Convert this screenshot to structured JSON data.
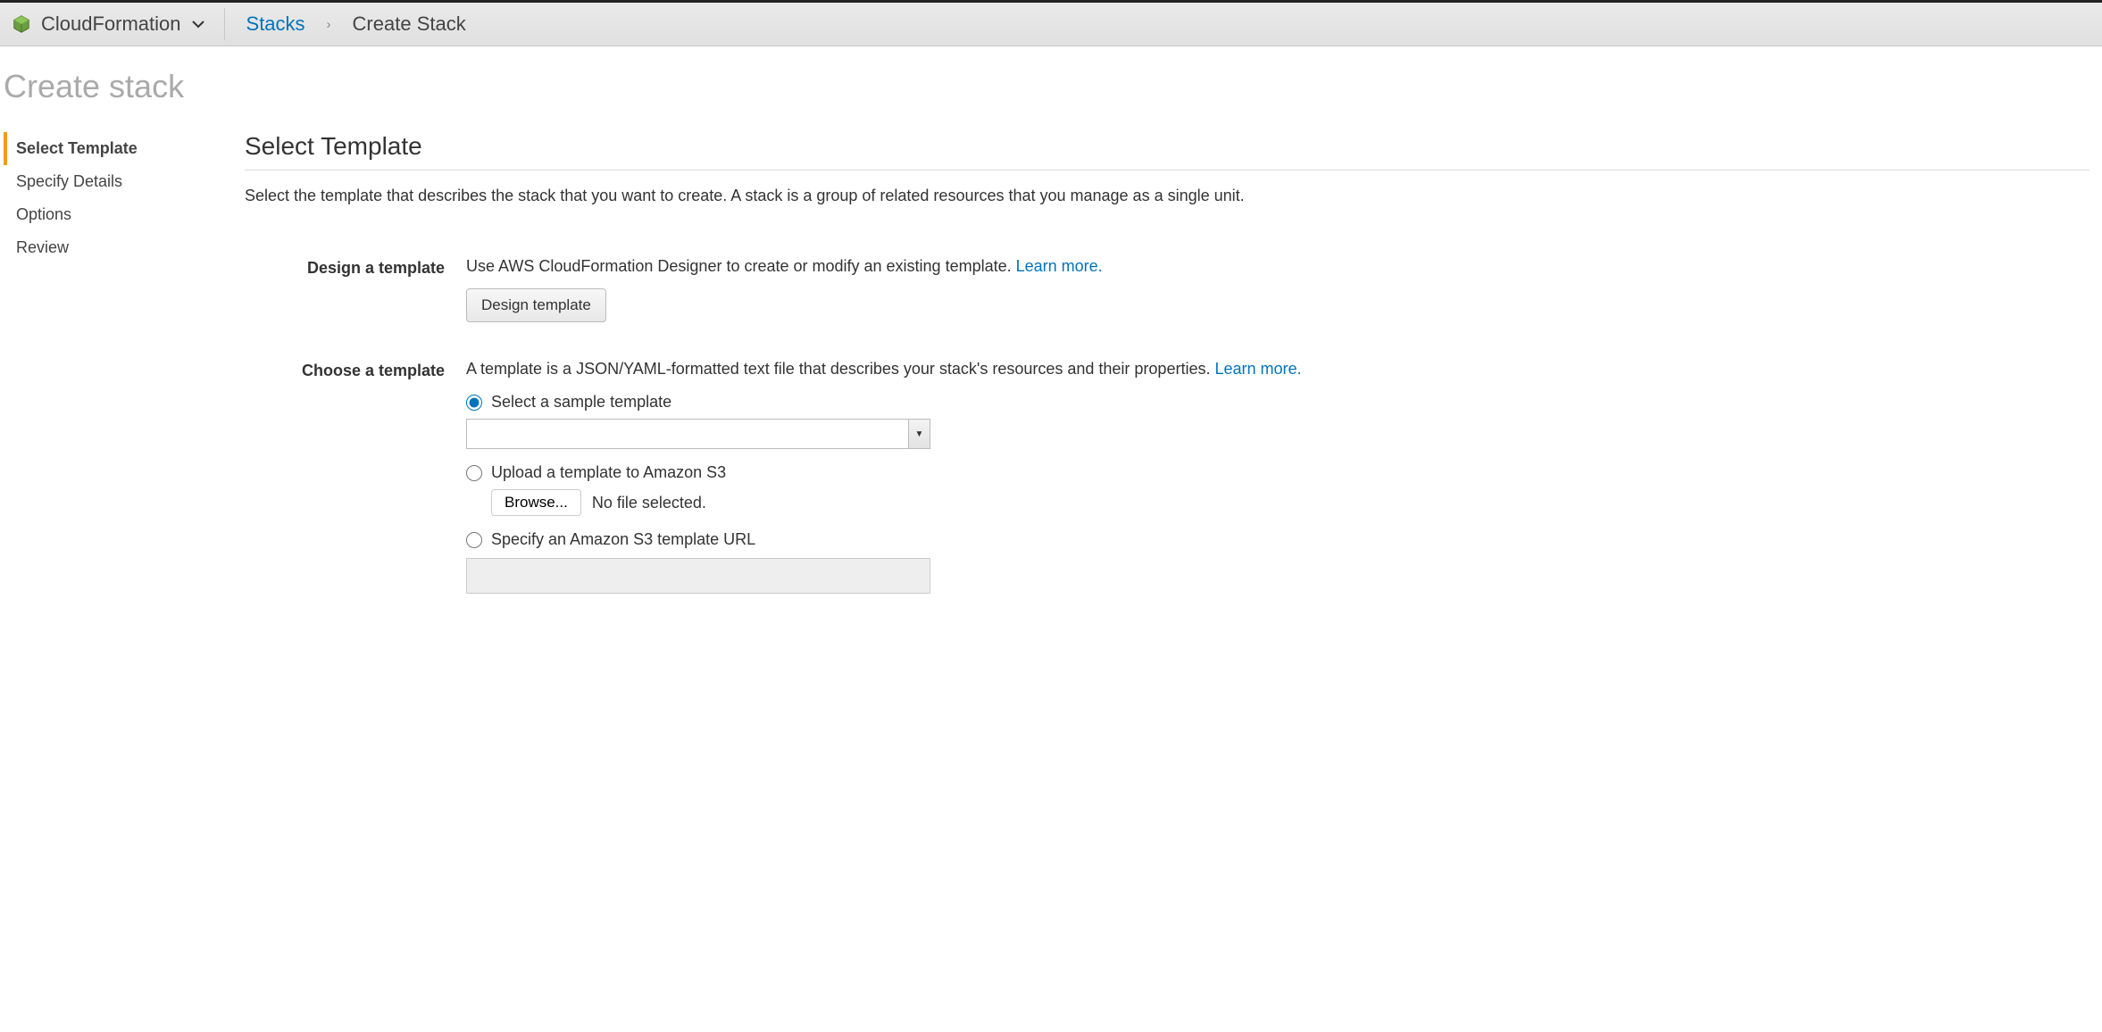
{
  "breadcrumb": {
    "service_name": "CloudFormation",
    "link_stacks": "Stacks",
    "current": "Create Stack"
  },
  "page_title": "Create stack",
  "sidebar": {
    "items": [
      {
        "label": "Select Template",
        "active": true
      },
      {
        "label": "Specify Details",
        "active": false
      },
      {
        "label": "Options",
        "active": false
      },
      {
        "label": "Review",
        "active": false
      }
    ]
  },
  "section": {
    "title": "Select Template",
    "description": "Select the template that describes the stack that you want to create. A stack is a group of related resources that you manage as a single unit."
  },
  "design": {
    "label": "Design a template",
    "help": "Use AWS CloudFormation Designer to create or modify an existing template. ",
    "learn_more": "Learn more.",
    "button": "Design template"
  },
  "choose": {
    "label": "Choose a template",
    "help": "A template is a JSON/YAML-formatted text file that describes your stack's resources and their properties. ",
    "learn_more": "Learn more.",
    "radio_sample": "Select a sample template",
    "radio_upload": "Upload a template to Amazon S3",
    "radio_url": "Specify an Amazon S3 template URL",
    "browse_button": "Browse...",
    "no_file": "No file selected.",
    "sample_select_value": "",
    "url_value": ""
  }
}
